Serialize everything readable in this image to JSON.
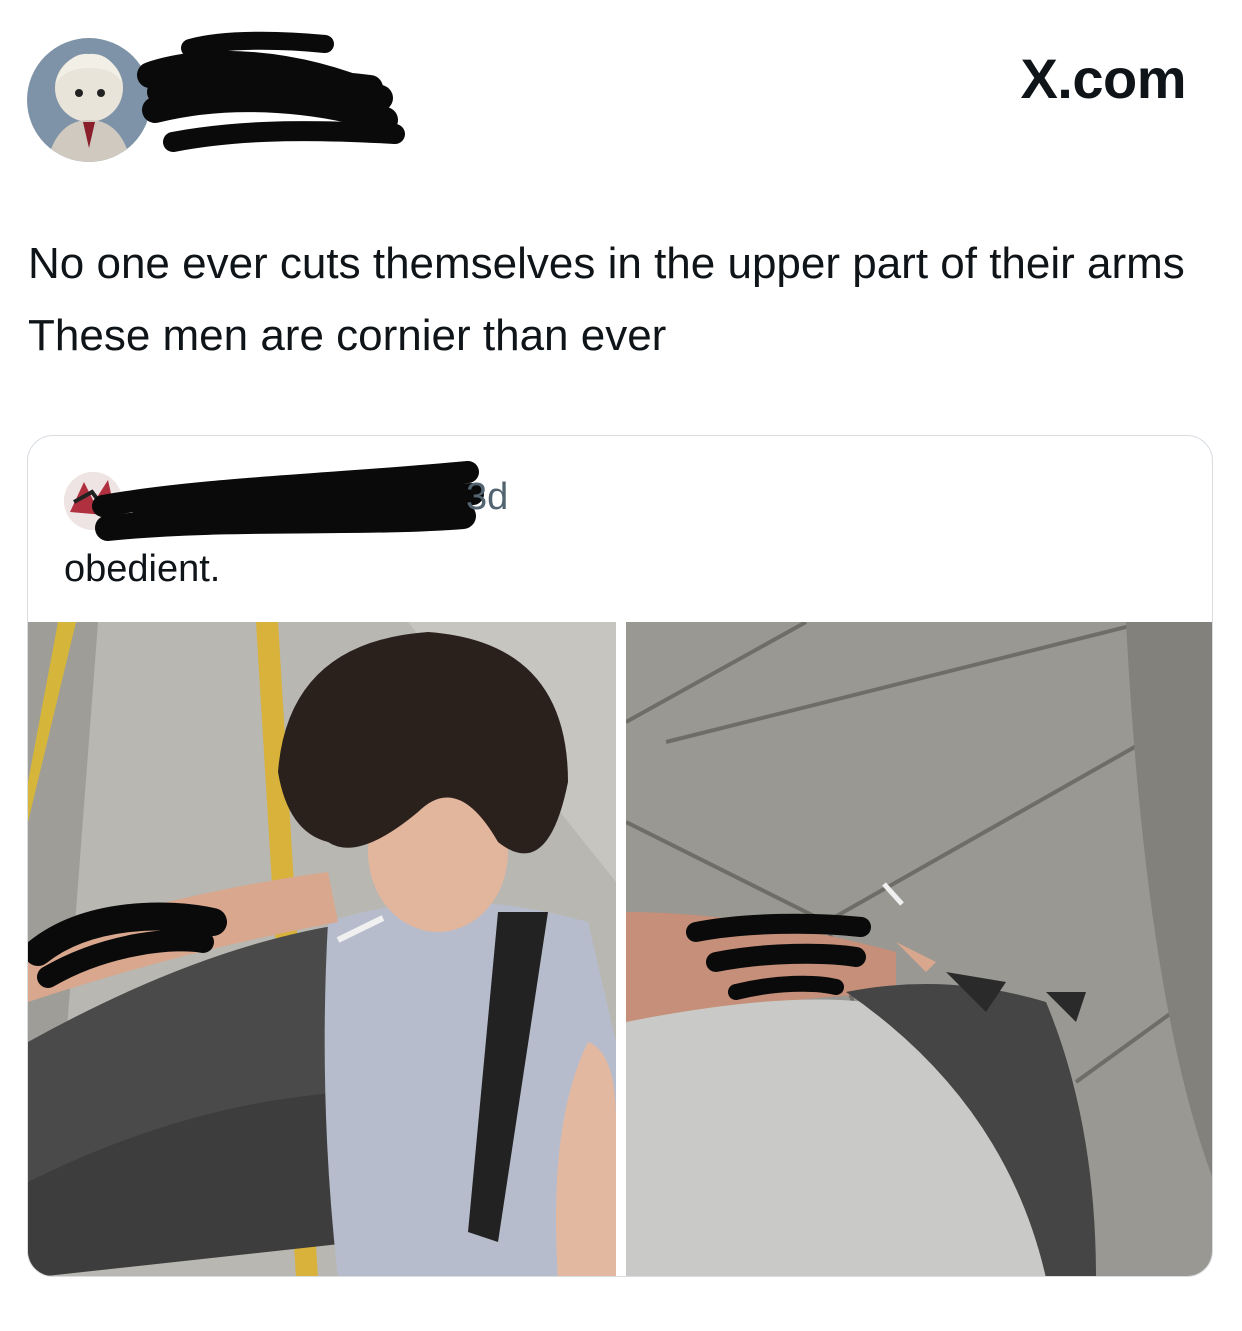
{
  "header": {
    "brand": "X.com",
    "avatar_icon": "profile-avatar-icon",
    "name_redacted": true
  },
  "tweet": {
    "text": "No one ever cuts themselves in the upper part of their arms These men are cornier than ever"
  },
  "quoted_tweet": {
    "time": "3d",
    "text": "obedient.",
    "name_redacted": true,
    "media": [
      {
        "name": "selfie-photo",
        "alt": ""
      },
      {
        "name": "sidewalk-photo",
        "alt": ""
      }
    ]
  },
  "colors": {
    "text": "#0f1419",
    "secondary": "#536471",
    "border": "#d8dde2",
    "redaction": "#0a0a0a"
  }
}
